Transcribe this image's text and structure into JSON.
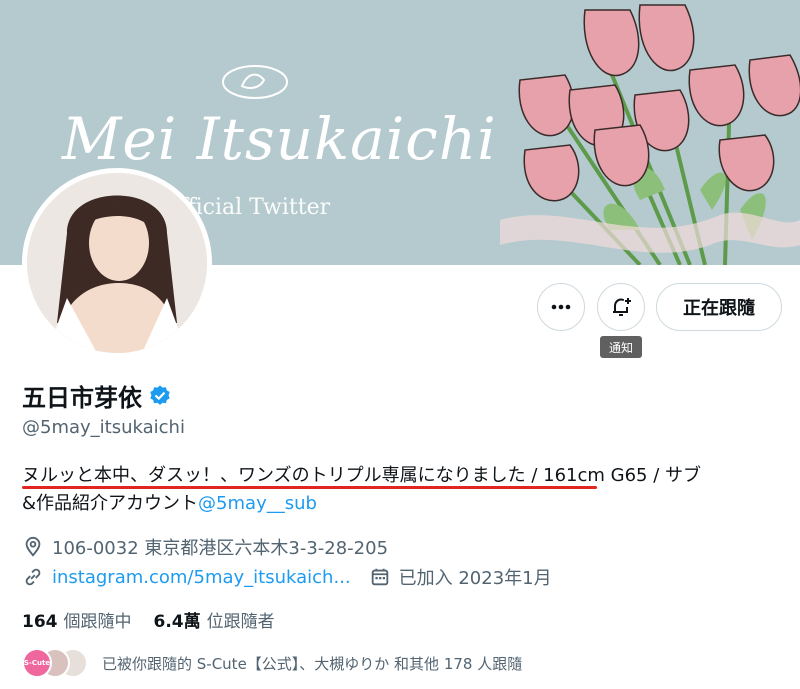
{
  "banner": {
    "title": "Mei Itsukaichi",
    "subtitle": "fficial Twitter"
  },
  "actions": {
    "more_label": "···",
    "notify_tooltip": "通知",
    "follow_label": "正在跟隨"
  },
  "profile": {
    "name": "五日市芽依",
    "handle": "@5may_itsukaichi",
    "bio_line1": "ヌルッと本中、ダスッ！、ワンズのトリプル専属になりました  / 161cm G65  / サブ",
    "bio_line2_prefix": "&作品紹介アカウント",
    "bio_mention": "@5may__sub",
    "location": "106-0032 東京都港区六本木3-3-28-205",
    "website": "instagram.com/5may_itsukaich...",
    "joined": "已加入 2023年1月"
  },
  "counts": {
    "following_value": "164",
    "following_label": "個跟隨中",
    "followers_value": "6.4萬",
    "followers_label": "位跟隨者"
  },
  "followed_by": {
    "text": "已被你跟隨的 S-Cute【公式】、大槻ゆりか 和其他 178 人跟隨",
    "badge": "S-Cute"
  },
  "colors": {
    "banner": "#b5cace",
    "link": "#1d9bf0",
    "verified": "#1d9bf0",
    "underline": "#e0261e"
  },
  "icons": [
    "more-icon",
    "notification-bell-icon",
    "verified-badge-icon",
    "location-icon",
    "link-icon",
    "calendar-icon"
  ]
}
